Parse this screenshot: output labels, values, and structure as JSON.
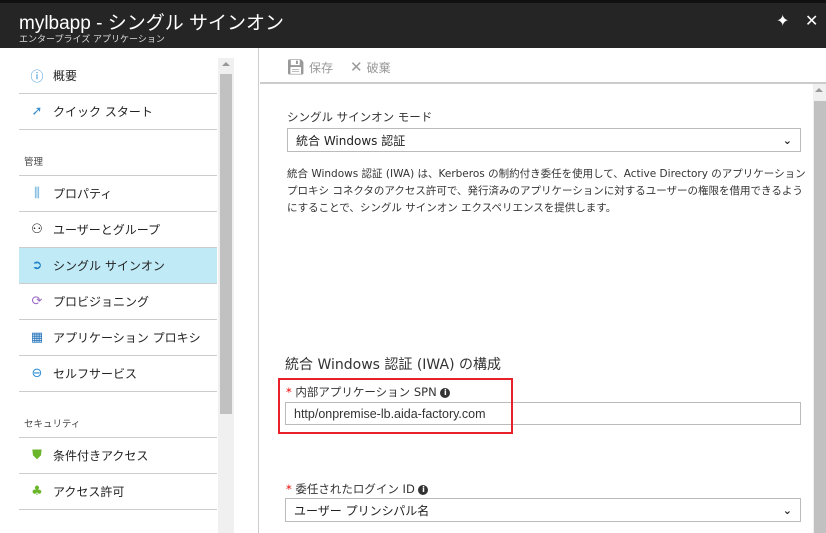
{
  "header": {
    "title": "mylbapp - シングル サインオン",
    "subtitle": "エンタープライズ アプリケーション",
    "pin_icon": "pin-icon",
    "close_icon": "close-icon"
  },
  "sidebar": {
    "items": [
      {
        "label": "概要",
        "icon": "info-icon"
      },
      {
        "label": "クイック スタート",
        "icon": "rocket-icon"
      }
    ],
    "groups": [
      {
        "label": "管理",
        "items": [
          {
            "label": "プロパティ",
            "icon": "properties-icon"
          },
          {
            "label": "ユーザーとグループ",
            "icon": "users-icon"
          },
          {
            "label": "シングル サインオン",
            "icon": "sso-icon",
            "selected": true
          },
          {
            "label": "プロビジョニング",
            "icon": "provisioning-icon"
          },
          {
            "label": "アプリケーション プロキシ",
            "icon": "app-proxy-icon"
          },
          {
            "label": "セルフサービス",
            "icon": "self-service-icon"
          }
        ]
      },
      {
        "label": "セキュリティ",
        "items": [
          {
            "label": "条件付きアクセス",
            "icon": "shield-icon"
          },
          {
            "label": "アクセス許可",
            "icon": "permissions-icon"
          }
        ]
      }
    ]
  },
  "toolbar": {
    "save_label": "保存",
    "discard_label": "破棄"
  },
  "main": {
    "mode_label": "シングル サインオン モード",
    "mode_value": "統合 Windows 認証",
    "description": "統合 Windows 認証 (IWA) は、Kerberos の制約付き委任を使用して、Active Directory のアプリケーション プロキシ コネクタのアクセス許可で、発行済みのアプリケーションに対するユーザーの権限を借用できるようにすることで、シングル サインオン エクスペリエンスを提供します。",
    "section_title": "統合 Windows 認証 (IWA) の構成",
    "spn_label": "内部アプリケーション SPN",
    "spn_value": "http/onpremise-lb.aida-factory.com",
    "login_label": "委任されたログイン ID",
    "login_value": "ユーザー プリンシパル名",
    "required_mark": "*",
    "highlight_color": "#e8202a",
    "selected_color": "#c1eaf7"
  }
}
